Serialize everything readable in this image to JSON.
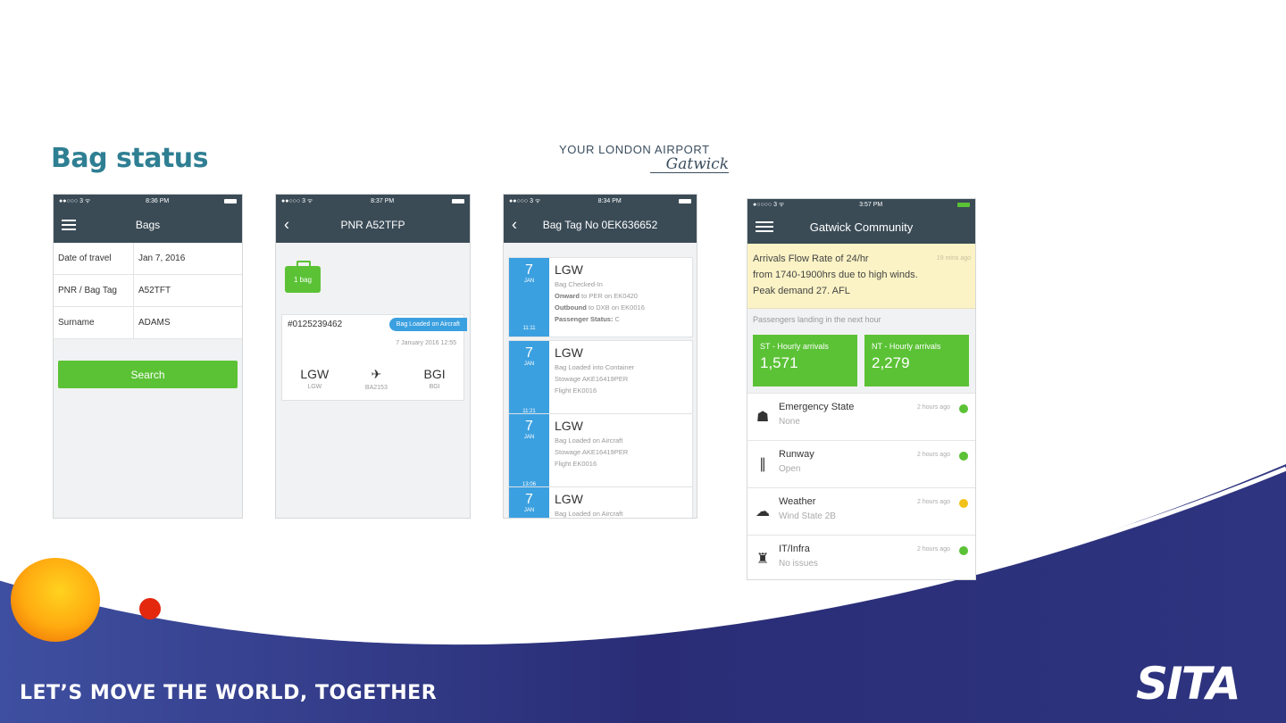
{
  "slide": {
    "title": "Bag status",
    "tagline": "LET’S MOVE THE WORLD, TOGETHER",
    "brand": "SITA",
    "colors": {
      "title": "#2f7f93",
      "navy": "#2a2d76",
      "green": "#5bc236",
      "blue": "#3ba0e0"
    }
  },
  "gatwick_logo": {
    "line1": "YOUR LONDON AIRPORT",
    "line2": "Gatwick"
  },
  "phone1": {
    "status": {
      "carrier": "●●○○○ 3 ᯤ",
      "time": "8:36 PM"
    },
    "nav_title": "Bags",
    "fields": [
      {
        "label": "Date of travel",
        "value": "Jan 7, 2016"
      },
      {
        "label": "PNR / Bag Tag",
        "value": "A52TFT"
      },
      {
        "label": "Surname",
        "value": "ADAMS"
      }
    ],
    "search_label": "Search"
  },
  "phone2": {
    "status": {
      "carrier": "●●○○○ 3 ᯤ",
      "time": "8:37 PM"
    },
    "nav_title": "PNR A52TFP",
    "bag_count": "1 bag",
    "tag_number": "#0125239462",
    "pill": "Bag Loaded on Aircraft",
    "timestamp": "7 January 2016 12:55",
    "from": {
      "code": "LGW",
      "sub": "LGW"
    },
    "flight": "BA2153",
    "to": {
      "code": "BGI",
      "sub": "BGI"
    }
  },
  "phone3": {
    "status": {
      "carrier": "●●○○○ 3 ᯤ",
      "time": "8:34 PM"
    },
    "nav_title": "Bag Tag No 0EK636652",
    "events": [
      {
        "day": "7",
        "month": "JAN",
        "time": "11:11",
        "airport": "LGW",
        "line1": "Bag Checked-In",
        "line2_bold": "Onward",
        "line2": " to PER on EK0420",
        "line3_bold": "Outbound",
        "line3": " to DXB on EK0016",
        "line4_bold": "Passenger Status:",
        "line4": " C"
      },
      {
        "day": "7",
        "month": "JAN",
        "time": "11:21",
        "airport": "LGW",
        "line1": "Bag Loaded into Container",
        "line2_bold": "",
        "line2": "Stowage AKE16419PER",
        "line3_bold": "",
        "line3": "Flight EK0016",
        "line4_bold": "",
        "line4": ""
      },
      {
        "day": "7",
        "month": "JAN",
        "time": "13:06",
        "airport": "LGW",
        "line1": "Bag Loaded on Aircraft",
        "line2_bold": "",
        "line2": "Stowage AKE16419PER",
        "line3_bold": "",
        "line3": "Flight EK0016",
        "line4_bold": "",
        "line4": ""
      },
      {
        "day": "7",
        "month": "JAN",
        "time": "",
        "airport": "LGW",
        "line1": "Bag Loaded on Aircraft",
        "line2_bold": "",
        "line2": "",
        "line3_bold": "",
        "line3": "",
        "line4_bold": "",
        "line4": ""
      }
    ]
  },
  "phone4": {
    "status": {
      "carrier": "●○○○○ 3 ᯤ",
      "time": "3:57 PM"
    },
    "nav_title": "Gatwick Community",
    "alert": {
      "line1": "Arrivals Flow Rate of 24/hr",
      "line2": "from 1740-1900hrs due to high winds.",
      "line3": "Peak demand 27. AFL",
      "ago": "19 mins ago"
    },
    "pax_label": "Passengers landing in the next hour",
    "tiles": [
      {
        "label": "ST - Hourly arrivals",
        "value": "1,571"
      },
      {
        "label": "NT - Hourly arrivals",
        "value": "2,279"
      }
    ],
    "statuses": [
      {
        "icon": "emergency-icon",
        "glyph": "☗",
        "name": "Emergency State",
        "sub": "None",
        "ago": "2 hours ago",
        "color": "#5bc236"
      },
      {
        "icon": "runway-icon",
        "glyph": "∥",
        "name": "Runway",
        "sub": "Open",
        "ago": "2 hours ago",
        "color": "#5bc236"
      },
      {
        "icon": "weather-icon",
        "glyph": "☁",
        "name": "Weather",
        "sub": "Wind State 2B",
        "ago": "2 hours ago",
        "color": "#f2c11a"
      },
      {
        "icon": "infra-icon",
        "glyph": "♜",
        "name": "IT/Infra",
        "sub": "No issues",
        "ago": "2 hours ago",
        "color": "#5bc236"
      }
    ]
  }
}
